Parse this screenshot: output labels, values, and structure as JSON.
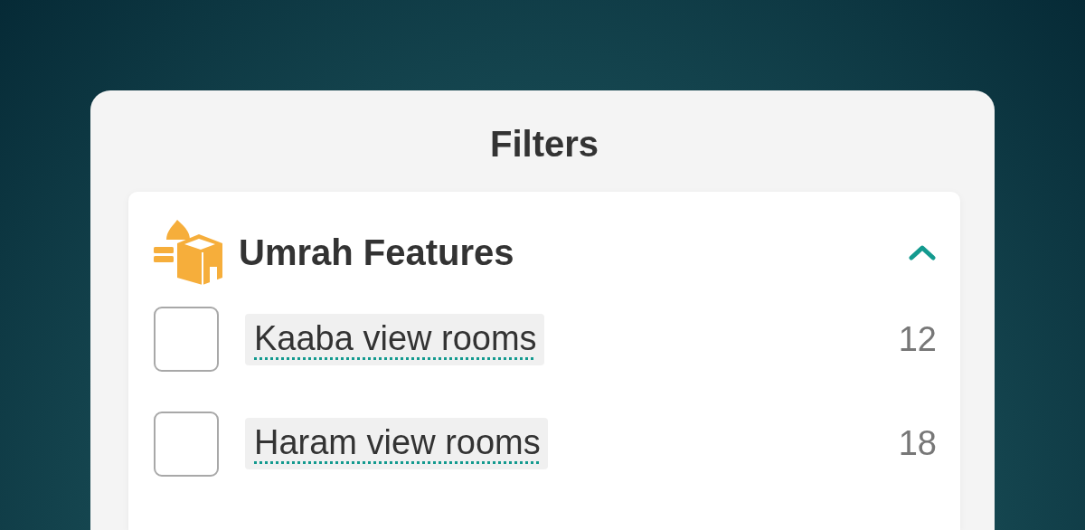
{
  "panel": {
    "title": "Filters"
  },
  "section": {
    "title": "Umrah Features",
    "expanded": true,
    "options": [
      {
        "label": "Kaaba view rooms",
        "count": "12",
        "checked": false
      },
      {
        "label": "Haram view rooms",
        "count": "18",
        "checked": false
      }
    ]
  }
}
